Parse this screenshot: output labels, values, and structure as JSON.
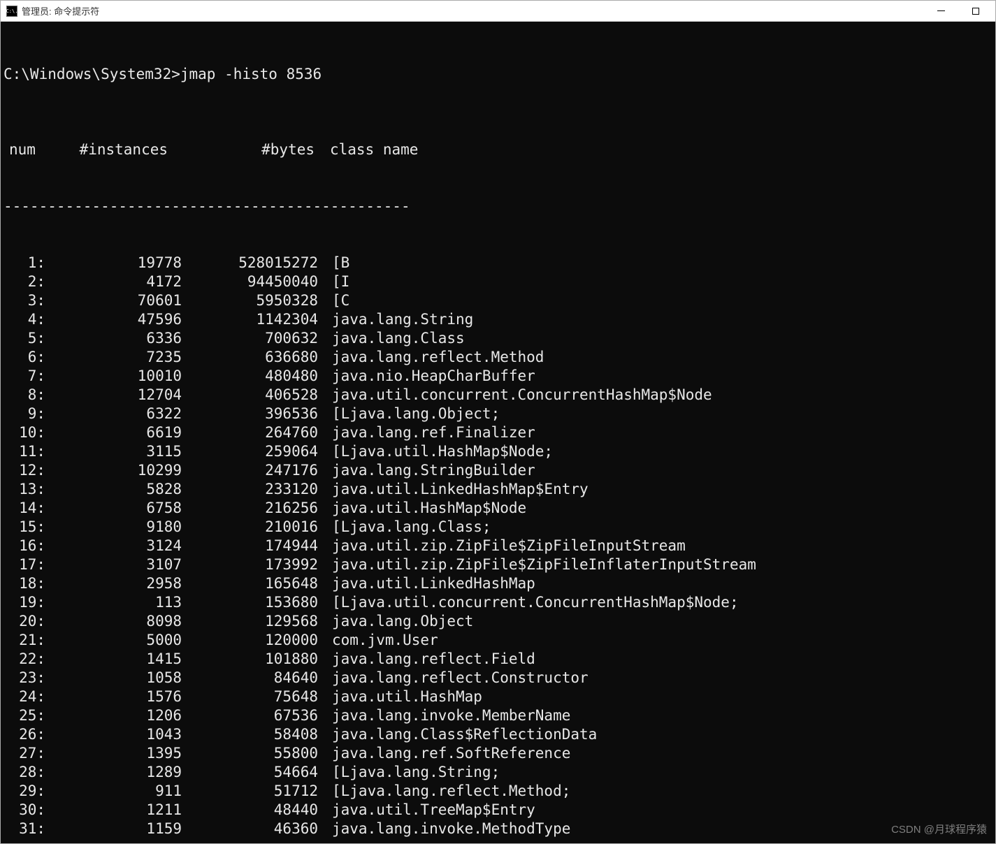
{
  "window": {
    "icon_text": "C:\\.",
    "title": "管理员: 命令提示符"
  },
  "terminal": {
    "prompt": "C:\\Windows\\System32>",
    "command": "jmap -histo 8536",
    "headers": {
      "num": "num",
      "instances": "#instances",
      "bytes": "#bytes",
      "class": "class name"
    },
    "divider": "----------------------------------------------",
    "rows": [
      {
        "num": "1:",
        "instances": "19778",
        "bytes": "528015272",
        "class": "[B"
      },
      {
        "num": "2:",
        "instances": "4172",
        "bytes": "94450040",
        "class": "[I"
      },
      {
        "num": "3:",
        "instances": "70601",
        "bytes": "5950328",
        "class": "[C"
      },
      {
        "num": "4:",
        "instances": "47596",
        "bytes": "1142304",
        "class": "java.lang.String"
      },
      {
        "num": "5:",
        "instances": "6336",
        "bytes": "700632",
        "class": "java.lang.Class"
      },
      {
        "num": "6:",
        "instances": "7235",
        "bytes": "636680",
        "class": "java.lang.reflect.Method"
      },
      {
        "num": "7:",
        "instances": "10010",
        "bytes": "480480",
        "class": "java.nio.HeapCharBuffer"
      },
      {
        "num": "8:",
        "instances": "12704",
        "bytes": "406528",
        "class": "java.util.concurrent.ConcurrentHashMap$Node"
      },
      {
        "num": "9:",
        "instances": "6322",
        "bytes": "396536",
        "class": "[Ljava.lang.Object;"
      },
      {
        "num": "10:",
        "instances": "6619",
        "bytes": "264760",
        "class": "java.lang.ref.Finalizer"
      },
      {
        "num": "11:",
        "instances": "3115",
        "bytes": "259064",
        "class": "[Ljava.util.HashMap$Node;"
      },
      {
        "num": "12:",
        "instances": "10299",
        "bytes": "247176",
        "class": "java.lang.StringBuilder"
      },
      {
        "num": "13:",
        "instances": "5828",
        "bytes": "233120",
        "class": "java.util.LinkedHashMap$Entry"
      },
      {
        "num": "14:",
        "instances": "6758",
        "bytes": "216256",
        "class": "java.util.HashMap$Node"
      },
      {
        "num": "15:",
        "instances": "9180",
        "bytes": "210016",
        "class": "[Ljava.lang.Class;"
      },
      {
        "num": "16:",
        "instances": "3124",
        "bytes": "174944",
        "class": "java.util.zip.ZipFile$ZipFileInputStream"
      },
      {
        "num": "17:",
        "instances": "3107",
        "bytes": "173992",
        "class": "java.util.zip.ZipFile$ZipFileInflaterInputStream"
      },
      {
        "num": "18:",
        "instances": "2958",
        "bytes": "165648",
        "class": "java.util.LinkedHashMap"
      },
      {
        "num": "19:",
        "instances": "113",
        "bytes": "153680",
        "class": "[Ljava.util.concurrent.ConcurrentHashMap$Node;"
      },
      {
        "num": "20:",
        "instances": "8098",
        "bytes": "129568",
        "class": "java.lang.Object"
      },
      {
        "num": "21:",
        "instances": "5000",
        "bytes": "120000",
        "class": "com.jvm.User"
      },
      {
        "num": "22:",
        "instances": "1415",
        "bytes": "101880",
        "class": "java.lang.reflect.Field"
      },
      {
        "num": "23:",
        "instances": "1058",
        "bytes": "84640",
        "class": "java.lang.reflect.Constructor"
      },
      {
        "num": "24:",
        "instances": "1576",
        "bytes": "75648",
        "class": "java.util.HashMap"
      },
      {
        "num": "25:",
        "instances": "1206",
        "bytes": "67536",
        "class": "java.lang.invoke.MemberName"
      },
      {
        "num": "26:",
        "instances": "1043",
        "bytes": "58408",
        "class": "java.lang.Class$ReflectionData"
      },
      {
        "num": "27:",
        "instances": "1395",
        "bytes": "55800",
        "class": "java.lang.ref.SoftReference"
      },
      {
        "num": "28:",
        "instances": "1289",
        "bytes": "54664",
        "class": "[Ljava.lang.String;"
      },
      {
        "num": "29:",
        "instances": "911",
        "bytes": "51712",
        "class": "[Ljava.lang.reflect.Method;"
      },
      {
        "num": "30:",
        "instances": "1211",
        "bytes": "48440",
        "class": "java.util.TreeMap$Entry"
      },
      {
        "num": "31:",
        "instances": "1159",
        "bytes": "46360",
        "class": "java.lang.invoke.MethodType"
      }
    ]
  },
  "watermark": "CSDN @月球程序猿"
}
